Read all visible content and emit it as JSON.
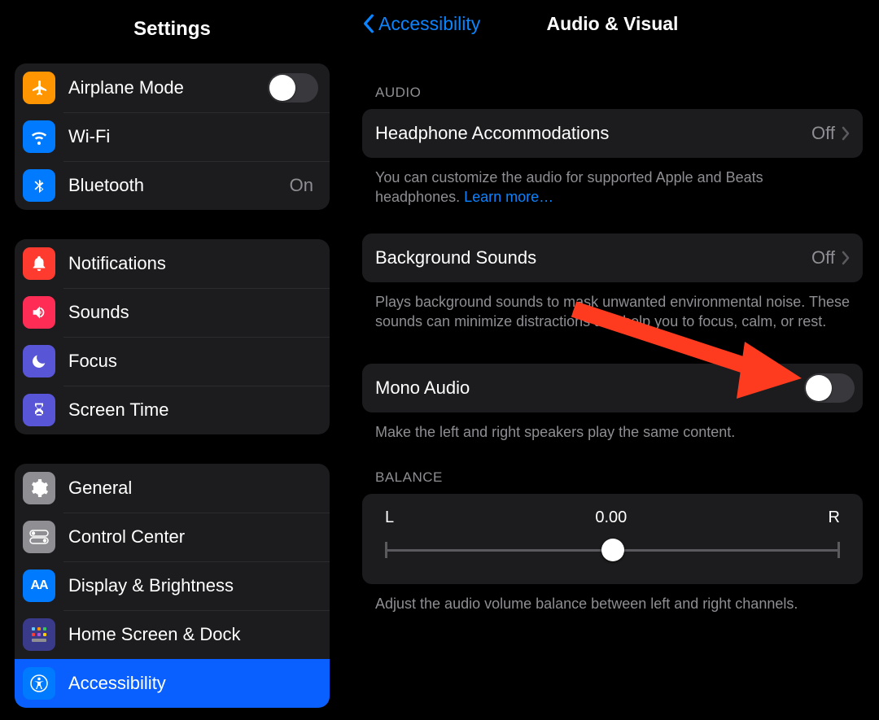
{
  "left": {
    "title": "Settings",
    "group1": [
      {
        "icon": "airplane",
        "color": "c-orange",
        "label": "Airplane Mode",
        "toggle": false
      },
      {
        "icon": "wifi",
        "color": "c-blue",
        "label": "Wi-Fi",
        "value": ""
      },
      {
        "icon": "bluetooth",
        "color": "c-blue",
        "label": "Bluetooth",
        "value": "On"
      }
    ],
    "group2": [
      {
        "icon": "bell",
        "color": "c-red",
        "label": "Notifications"
      },
      {
        "icon": "speaker",
        "color": "c-pink",
        "label": "Sounds"
      },
      {
        "icon": "moon",
        "color": "c-indigo",
        "label": "Focus"
      },
      {
        "icon": "hourglass",
        "color": "c-indigo",
        "label": "Screen Time"
      }
    ],
    "group3": [
      {
        "icon": "gear",
        "color": "c-gray",
        "label": "General"
      },
      {
        "icon": "switches",
        "color": "c-gray2",
        "label": "Control Center"
      },
      {
        "icon": "aa",
        "color": "c-blue",
        "label": "Display & Brightness"
      },
      {
        "icon": "grid",
        "color": "c-grid",
        "label": "Home Screen & Dock"
      },
      {
        "icon": "person",
        "color": "c-blue",
        "label": "Accessibility",
        "selected": true
      }
    ]
  },
  "right": {
    "back_label": "Accessibility",
    "title": "Audio & Visual",
    "audio_header": "AUDIO",
    "headphone": {
      "label": "Headphone Accommodations",
      "value": "Off"
    },
    "headphone_caption": "You can customize the audio for supported Apple and Beats headphones. ",
    "learn_more": "Learn more…",
    "bg": {
      "label": "Background Sounds",
      "value": "Off"
    },
    "bg_caption": "Plays background sounds to mask unwanted environmental noise. These sounds can minimize distractions and help you to focus, calm, or rest.",
    "mono": {
      "label": "Mono Audio"
    },
    "mono_caption": "Make the left and right speakers play the same content.",
    "balance_header": "BALANCE",
    "balance": {
      "L": "L",
      "R": "R",
      "value": "0.00"
    },
    "balance_caption": "Adjust the audio volume balance between left and right channels."
  }
}
